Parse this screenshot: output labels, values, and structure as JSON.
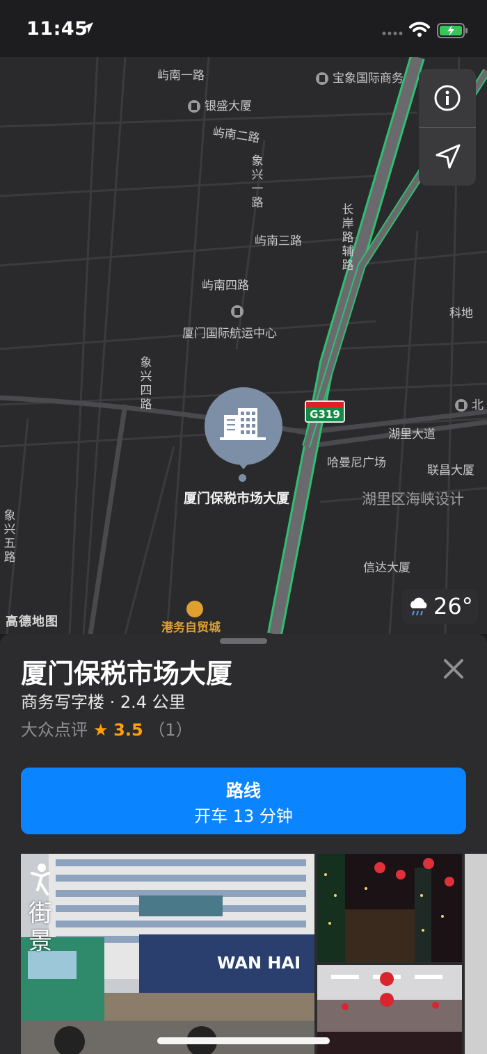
{
  "status": {
    "time": "11:45"
  },
  "map": {
    "roads": [
      "屿南一路",
      "银盛大厦",
      "屿南二路",
      "象兴一路",
      "屿南三路",
      "长岸路辅路",
      "屿南四路",
      "厦门国际航运中心",
      "象兴四路",
      "湖里大道",
      "哈曼尼广场",
      "联昌大厦",
      "湖里区海峡设计",
      "信达大厦",
      "象兴五路",
      "宝象国际商务",
      "科地",
      "北"
    ],
    "shield": "G319",
    "pin_label": "厦门保税市场大厦",
    "shop_label": "港务自贸城",
    "attribution": "高德地图",
    "weather": {
      "temp": "26°",
      "icon": "rain-cloud-icon"
    }
  },
  "place": {
    "name": "厦门保税市场大厦",
    "category_distance": "商务写字楼 · 2.4 公里",
    "source": "大众点评",
    "score": "3.5",
    "count": "（1）"
  },
  "route_button": {
    "title": "路线",
    "subtitle": "开车 13 分钟"
  },
  "photos": {
    "street_view_label": "街景",
    "truck_text": "WAN HAI"
  },
  "colors": {
    "accent": "#0a84ff",
    "star": "#ff9f0a",
    "highway": "#2fbf71"
  }
}
